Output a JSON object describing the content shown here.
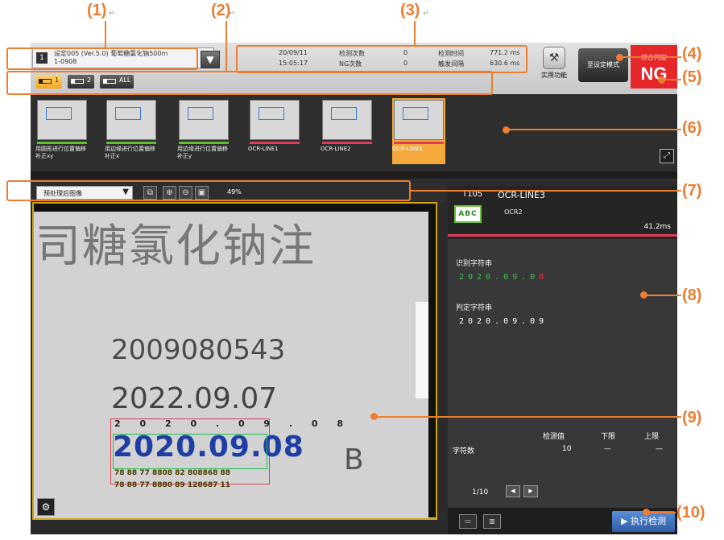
{
  "callouts": {
    "c1": "(1)",
    "c2": "(2)",
    "c3": "(3)",
    "c4": "(4)",
    "c5": "(5)",
    "c6": "(6)",
    "c7": "(7)",
    "c8": "(8)",
    "c9": "(9)",
    "c10": "(10)"
  },
  "para_mark": "↵",
  "topbar": {
    "setting_icon": "1",
    "setting_line1": "设定005 (Ver.5.0) 葡萄糖氯化钠500m",
    "setting_line2": "1-0908",
    "dropdown_glyph": "▼",
    "stats": {
      "date": "20/09/11",
      "time": "15:05:17",
      "count_label": "检测次数",
      "count_value": "0",
      "ng_label": "NG次数",
      "ng_value": "0",
      "dtime_label": "检测时间",
      "dtime_value": "771.2 ms",
      "trigger_label": "触发间隔",
      "trigger_value": "630.6 ms"
    },
    "tools_label": "实用功能",
    "mode_label": "至设定模式",
    "judge_small": "综合判定",
    "judge_big": "NG"
  },
  "tabs": [
    {
      "label": "1"
    },
    {
      "label": "2"
    },
    {
      "label": "ALL"
    }
  ],
  "thumbs": [
    {
      "label": "用圆形进行位置偏移补正xy",
      "bar_color": "#5fbf2a"
    },
    {
      "label": "用边缘进行位置偏移补正x",
      "bar_color": "#5fbf2a"
    },
    {
      "label": "用边缘进行位置偏移补正y",
      "bar_color": "#5fbf2a"
    },
    {
      "label": "OCR-LINE1",
      "bar_color": "#e23a58"
    },
    {
      "label": "OCR-LINE2",
      "bar_color": "#e23a58"
    },
    {
      "label": "OCR-LINE3",
      "bar_color": "#e23a58"
    }
  ],
  "image_toolbar": {
    "select_value": "预处理后图像",
    "select_arrow": "▼",
    "zoom_level": "49%"
  },
  "image": {
    "top_text": "司糖氯化钠注",
    "line1": "2009080543",
    "line2": "2022.09.07",
    "ocr_row": "2 0 2 0 . 0 9 . 0 8",
    "ocr_main": "2020.09.08",
    "sub1": "78 88 77 8808 82 808868 88",
    "sub2": "78 88 77 8880 89 128687 11",
    "letter": "B"
  },
  "result_panel": {
    "tool_id": "T105",
    "tool_name": "OCR-LINE3",
    "icon_text": "ABC",
    "sub_type": "OCR2",
    "time": "41.2ms",
    "read_label": "识别字符串",
    "read_ok": "2020.09.0",
    "read_ng": "8",
    "judge_label": "判定字符串",
    "judge_value": "2020.09.09",
    "table": {
      "col1": "检测值",
      "col2": "下限",
      "col3": "上限",
      "row_label": "字符数",
      "row_value": "10",
      "row_low": "—",
      "row_high": "—"
    },
    "pager": "1/10",
    "exec_label": "执行检测"
  }
}
